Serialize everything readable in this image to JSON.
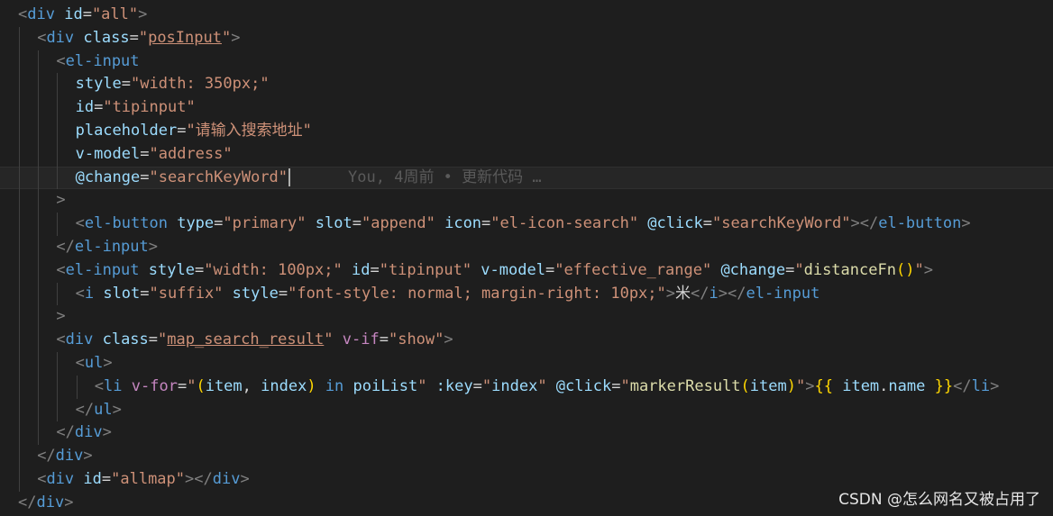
{
  "editor": {
    "current_line_index": 7,
    "blame_annotation": "You, 4周前 • 更新代码 …",
    "lines": [
      {
        "indent": 0,
        "tokens": [
          [
            "p",
            "<"
          ],
          [
            "t",
            "div"
          ],
          [
            "a",
            " id"
          ],
          [
            "x",
            "="
          ],
          [
            "s",
            "\"all\""
          ],
          [
            "p",
            ">"
          ]
        ]
      },
      {
        "indent": 1,
        "tokens": [
          [
            "p",
            "<"
          ],
          [
            "t",
            "div"
          ],
          [
            "a",
            " class"
          ],
          [
            "x",
            "="
          ],
          [
            "s",
            "\""
          ],
          [
            "u",
            "posInput"
          ],
          [
            "s",
            "\""
          ],
          [
            "p",
            ">"
          ]
        ]
      },
      {
        "indent": 2,
        "tokens": [
          [
            "p",
            "<"
          ],
          [
            "t",
            "el-input"
          ]
        ]
      },
      {
        "indent": 3,
        "tokens": [
          [
            "a",
            "style"
          ],
          [
            "x",
            "="
          ],
          [
            "s",
            "\"width: 350px;\""
          ]
        ]
      },
      {
        "indent": 3,
        "tokens": [
          [
            "a",
            "id"
          ],
          [
            "x",
            "="
          ],
          [
            "s",
            "\"tipinput\""
          ]
        ]
      },
      {
        "indent": 3,
        "tokens": [
          [
            "a",
            "placeholder"
          ],
          [
            "x",
            "="
          ],
          [
            "s",
            "\"请输入搜索地址\""
          ]
        ]
      },
      {
        "indent": 3,
        "tokens": [
          [
            "a",
            "v-model"
          ],
          [
            "x",
            "="
          ],
          [
            "s",
            "\"address\""
          ]
        ]
      },
      {
        "indent": 3,
        "tokens": [
          [
            "a",
            "@change"
          ],
          [
            "x",
            "="
          ],
          [
            "s",
            "\"searchKeyWord\""
          ]
        ]
      },
      {
        "indent": 2,
        "tokens": [
          [
            "p",
            ">"
          ]
        ]
      },
      {
        "indent": 3,
        "tokens": [
          [
            "p",
            "<"
          ],
          [
            "t",
            "el-button"
          ],
          [
            "a",
            " type"
          ],
          [
            "x",
            "="
          ],
          [
            "s",
            "\"primary\""
          ],
          [
            "a",
            " slot"
          ],
          [
            "x",
            "="
          ],
          [
            "s",
            "\"append\""
          ],
          [
            "a",
            " icon"
          ],
          [
            "x",
            "="
          ],
          [
            "s",
            "\"el-icon-search\""
          ],
          [
            "a",
            " @click"
          ],
          [
            "x",
            "="
          ],
          [
            "s",
            "\"searchKeyWord\""
          ],
          [
            "p",
            "></"
          ],
          [
            "t",
            "el-button"
          ],
          [
            "p",
            ">"
          ]
        ]
      },
      {
        "indent": 2,
        "tokens": [
          [
            "p",
            "</"
          ],
          [
            "t",
            "el-input"
          ],
          [
            "p",
            ">"
          ]
        ]
      },
      {
        "indent": 2,
        "tokens": [
          [
            "p",
            "<"
          ],
          [
            "t",
            "el-input"
          ],
          [
            "a",
            " style"
          ],
          [
            "x",
            "="
          ],
          [
            "s",
            "\"width: 100px;\""
          ],
          [
            "a",
            " id"
          ],
          [
            "x",
            "="
          ],
          [
            "s",
            "\"tipinput\""
          ],
          [
            "a",
            " v-model"
          ],
          [
            "x",
            "="
          ],
          [
            "s",
            "\"effective_range\""
          ],
          [
            "a",
            " @change"
          ],
          [
            "x",
            "="
          ],
          [
            "s",
            "\""
          ],
          [
            "f",
            "distanceFn"
          ],
          [
            "b",
            "()"
          ],
          [
            "s",
            "\""
          ],
          [
            "p",
            ">"
          ]
        ]
      },
      {
        "indent": 3,
        "tokens": [
          [
            "p",
            "<"
          ],
          [
            "t",
            "i"
          ],
          [
            "a",
            " slot"
          ],
          [
            "x",
            "="
          ],
          [
            "s",
            "\"suffix\""
          ],
          [
            "a",
            " style"
          ],
          [
            "x",
            "="
          ],
          [
            "s",
            "\"font-style: "
          ],
          [
            "s",
            "normal"
          ],
          [
            "s",
            "; margin-right: "
          ],
          [
            "s",
            "10px;\""
          ],
          [
            "p",
            ">"
          ],
          [
            "x",
            "米"
          ],
          [
            "p",
            "</"
          ],
          [
            "t",
            "i"
          ],
          [
            "p",
            "></"
          ],
          [
            "t",
            "el-input"
          ]
        ]
      },
      {
        "indent": 2,
        "tokens": [
          [
            "p",
            ">"
          ]
        ]
      },
      {
        "indent": 2,
        "tokens": [
          [
            "p",
            "<"
          ],
          [
            "t",
            "div"
          ],
          [
            "a",
            " class"
          ],
          [
            "x",
            "="
          ],
          [
            "s",
            "\""
          ],
          [
            "u",
            "map_search_result"
          ],
          [
            "s",
            "\""
          ],
          [
            "k",
            " v-if"
          ],
          [
            "x",
            "="
          ],
          [
            "s",
            "\"show\""
          ],
          [
            "p",
            ">"
          ]
        ]
      },
      {
        "indent": 3,
        "tokens": [
          [
            "p",
            "<"
          ],
          [
            "t",
            "ul"
          ],
          [
            "p",
            ">"
          ]
        ]
      },
      {
        "indent": 4,
        "tokens": [
          [
            "p",
            "<"
          ],
          [
            "t",
            "li"
          ],
          [
            "k",
            " v-for"
          ],
          [
            "x",
            "="
          ],
          [
            "s",
            "\""
          ],
          [
            "b",
            "("
          ],
          [
            "a",
            "item"
          ],
          [
            "x",
            ", "
          ],
          [
            "a",
            "index"
          ],
          [
            "b",
            ")"
          ],
          [
            "t",
            " in"
          ],
          [
            "a",
            " poiList"
          ],
          [
            "s",
            "\""
          ],
          [
            "a",
            " :key"
          ],
          [
            "x",
            "="
          ],
          [
            "s",
            "\""
          ],
          [
            "a",
            "index"
          ],
          [
            "s",
            "\""
          ],
          [
            "a",
            " @click"
          ],
          [
            "x",
            "="
          ],
          [
            "s",
            "\""
          ],
          [
            "f",
            "markerResult"
          ],
          [
            "b",
            "("
          ],
          [
            "a",
            "item"
          ],
          [
            "b",
            ")"
          ],
          [
            "s",
            "\""
          ],
          [
            "p",
            ">"
          ],
          [
            "b",
            "{{"
          ],
          [
            "a",
            " item"
          ],
          [
            "x",
            "."
          ],
          [
            "a",
            "name"
          ],
          [
            "b",
            " }}"
          ],
          [
            "p",
            "</"
          ],
          [
            "t",
            "li"
          ],
          [
            "p",
            ">"
          ]
        ]
      },
      {
        "indent": 3,
        "tokens": [
          [
            "p",
            "</"
          ],
          [
            "t",
            "ul"
          ],
          [
            "p",
            ">"
          ]
        ]
      },
      {
        "indent": 2,
        "tokens": [
          [
            "p",
            "</"
          ],
          [
            "t",
            "div"
          ],
          [
            "p",
            ">"
          ]
        ]
      },
      {
        "indent": 1,
        "tokens": [
          [
            "p",
            "</"
          ],
          [
            "t",
            "div"
          ],
          [
            "p",
            ">"
          ]
        ]
      },
      {
        "indent": 1,
        "tokens": [
          [
            "p",
            "<"
          ],
          [
            "t",
            "div"
          ],
          [
            "a",
            " id"
          ],
          [
            "x",
            "="
          ],
          [
            "s",
            "\"allmap\""
          ],
          [
            "p",
            "></"
          ],
          [
            "t",
            "div"
          ],
          [
            "p",
            ">"
          ]
        ]
      },
      {
        "indent": 0,
        "tokens": [
          [
            "p",
            "</"
          ],
          [
            "t",
            "div"
          ],
          [
            "p",
            ">"
          ]
        ]
      }
    ]
  },
  "watermark": {
    "text": "CSDN @怎么网名又被占用了"
  },
  "colors": {
    "background": "#1e1e1e",
    "tag": "#569cd6",
    "attribute": "#9cdcfe",
    "string": "#ce9178",
    "punctuation": "#808080",
    "keyword": "#c586c0",
    "function": "#dcdcaa",
    "brace": "#ffd700"
  }
}
